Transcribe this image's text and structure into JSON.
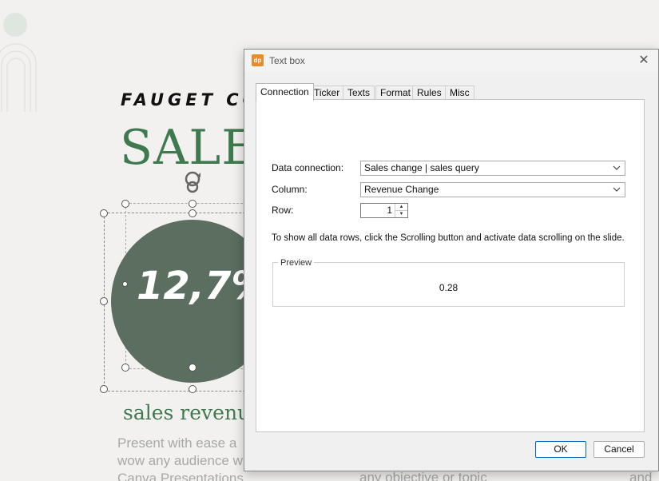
{
  "slide": {
    "company": "FAUGET CO",
    "title": "SALES",
    "circle_value": "12,7%",
    "subtitle": "sales revenu",
    "body_line1": "Present with ease a",
    "body_line2": "wow any audience w",
    "body_line3": "Canva Presentations",
    "body_col2": "any objective or topic",
    "body_col3": "and",
    "colors": {
      "green": "#3e7a4e",
      "circle": "#5b6e5f"
    }
  },
  "dialog": {
    "app_icon": "dp",
    "title": "Text box",
    "tabs": [
      {
        "label": "Connection",
        "active": true
      },
      {
        "label": "Ticker"
      },
      {
        "label": "Texts"
      },
      {
        "label": "Format"
      },
      {
        "label": "Rules"
      },
      {
        "label": "Misc"
      }
    ],
    "data_connection_label": "Data connection:",
    "data_connection_value": "Sales change | sales query",
    "column_label": "Column:",
    "column_value": "Revenue Change",
    "row_label": "Row:",
    "row_value": "1",
    "info_text": "To show all data rows, click the Scrolling button and activate data scrolling on the slide.",
    "preview_label": "Preview",
    "preview_value": "0.28",
    "ok_label": "OK",
    "cancel_label": "Cancel"
  }
}
